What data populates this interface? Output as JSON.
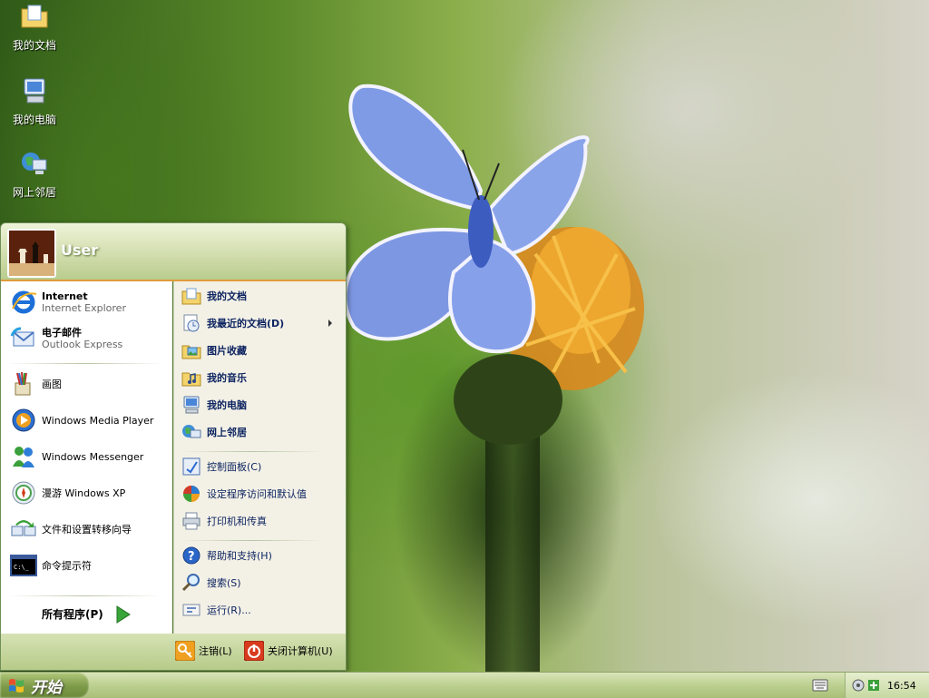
{
  "desktop": {
    "icons": [
      {
        "label": "我的文档",
        "icon": "folder-documents-icon"
      },
      {
        "label": "我的电脑",
        "icon": "my-computer-icon"
      },
      {
        "label": "网上邻居",
        "icon": "network-places-icon"
      }
    ]
  },
  "start_menu": {
    "user_name": "User",
    "left_items": [
      {
        "title": "Internet",
        "subtitle": "Internet Explorer",
        "icon": "internet-explorer-icon"
      },
      {
        "title": "电子邮件",
        "subtitle": "Outlook Express",
        "icon": "outlook-express-icon"
      },
      {
        "title": "画图",
        "icon": "paint-icon"
      },
      {
        "title": "Windows Media Player",
        "icon": "media-player-icon"
      },
      {
        "title": "Windows Messenger",
        "icon": "messenger-icon"
      },
      {
        "title": "漫游 Windows XP",
        "icon": "tour-xp-icon"
      },
      {
        "title": "文件和设置转移向导",
        "icon": "transfer-wizard-icon"
      },
      {
        "title": "命令提示符",
        "icon": "command-prompt-icon"
      }
    ],
    "all_programs": "所有程序(P)",
    "right_items": [
      {
        "label": "我的文档",
        "icon": "my-documents-icon"
      },
      {
        "label": "我最近的文档(D)",
        "icon": "recent-documents-icon"
      },
      {
        "label": "图片收藏",
        "icon": "my-pictures-icon"
      },
      {
        "label": "我的音乐",
        "icon": "my-music-icon"
      },
      {
        "label": "我的电脑",
        "icon": "my-computer-icon"
      },
      {
        "label": "网上邻居",
        "icon": "network-places-icon"
      },
      {
        "label": "控制面板(C)",
        "icon": "control-panel-icon"
      },
      {
        "label": "设定程序访问和默认值",
        "icon": "program-defaults-icon"
      },
      {
        "label": "打印机和传真",
        "icon": "printers-icon"
      },
      {
        "label": "帮助和支持(H)",
        "icon": "help-icon"
      },
      {
        "label": "搜索(S)",
        "icon": "search-icon"
      },
      {
        "label": "运行(R)...",
        "icon": "run-icon"
      }
    ],
    "logoff": "注销(L)",
    "shutdown": "关闭计算机(U)"
  },
  "taskbar": {
    "start_label": "开始",
    "clock": "16:54"
  },
  "colors": {
    "theme_olive": "#b9cc8e",
    "menu_accent": "#e09b3a",
    "link_text": "#0c2360"
  }
}
